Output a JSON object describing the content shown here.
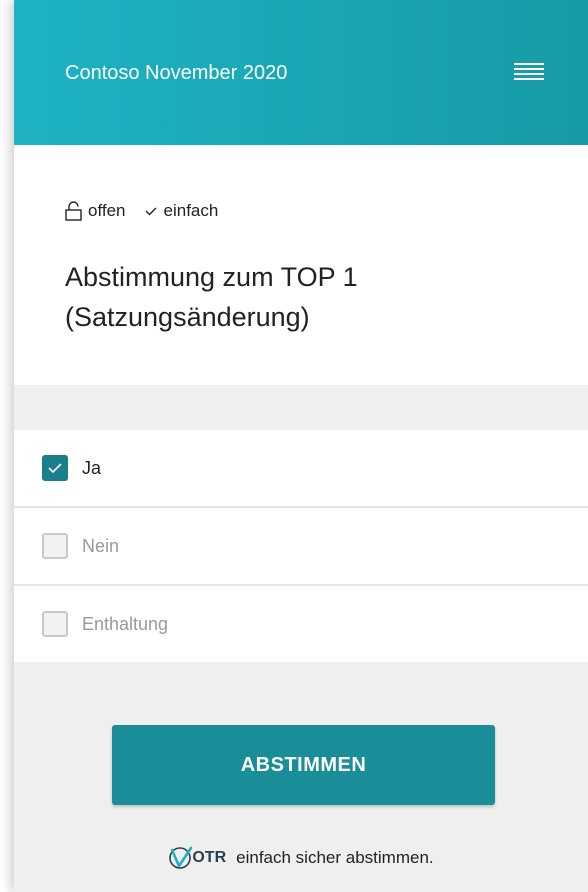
{
  "header": {
    "title": "Contoso November 2020",
    "menu_icon": "hamburger-menu-icon"
  },
  "poll": {
    "visibility": "offen",
    "visibility_icon": "lock-open-icon",
    "mode": "einfach",
    "mode_icon": "checkmark-icon",
    "question": "Abstimmung zum TOP 1 (Satzungsänderung)"
  },
  "options": [
    {
      "label": "Ja",
      "checked": true
    },
    {
      "label": "Nein",
      "checked": false
    },
    {
      "label": "Enthaltung",
      "checked": false
    }
  ],
  "action": {
    "vote_label": "ABSTIMMEN"
  },
  "footer": {
    "logo_text": "OTR",
    "tagline": "einfach sicher abstimmen."
  },
  "colors": {
    "header_gradient_start": "#1db3c3",
    "header_gradient_end": "#179ba6",
    "accent": "#1a8e98",
    "checkbox_checked": "#1a7f8b"
  }
}
